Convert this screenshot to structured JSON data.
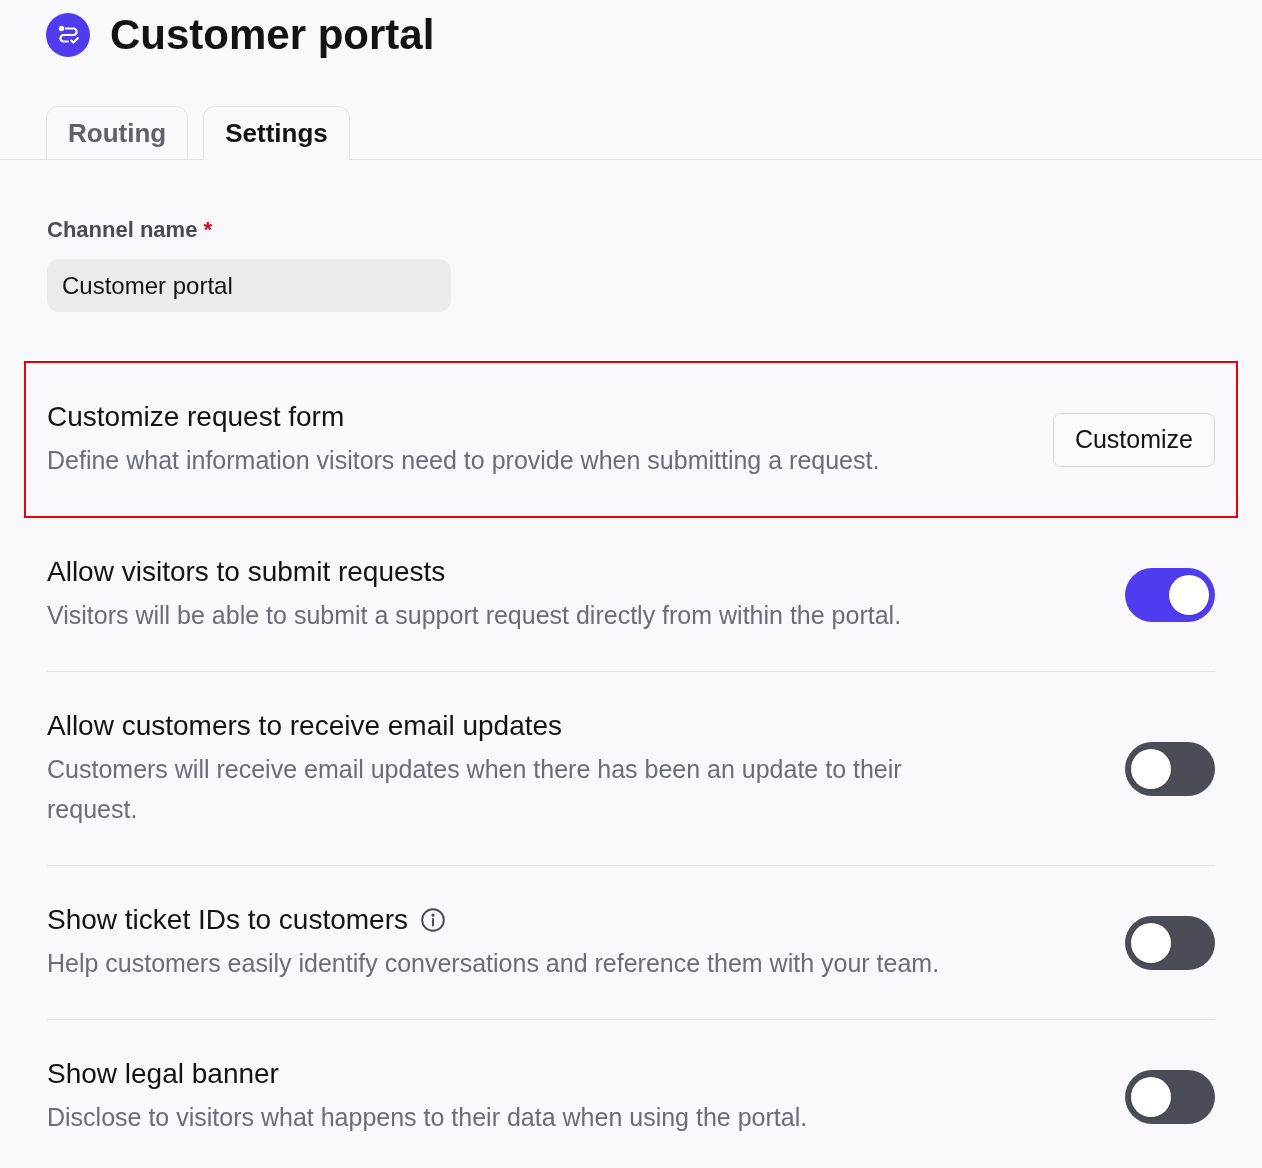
{
  "header": {
    "title": "Customer portal"
  },
  "tabs": [
    {
      "label": "Routing",
      "selected": false
    },
    {
      "label": "Settings",
      "selected": true
    }
  ],
  "channel_name": {
    "label": "Channel name",
    "required_mark": "*",
    "value": "Customer portal"
  },
  "settings": [
    {
      "kind": "button",
      "title": "Customize request form",
      "description": "Define what information visitors need to provide when submitting a request.",
      "button": "Customize",
      "highlighted": true
    },
    {
      "kind": "toggle",
      "title": "Allow visitors to submit requests",
      "description": "Visitors will be able to submit a support request directly from within the portal.",
      "on": true,
      "info": false
    },
    {
      "kind": "toggle",
      "title": "Allow customers to receive email updates",
      "description": "Customers will receive email updates when there has been an update to their request.",
      "on": false,
      "info": false
    },
    {
      "kind": "toggle",
      "title": "Show ticket IDs to customers",
      "description": "Help customers easily identify conversations and reference them with your team.",
      "on": false,
      "info": true
    },
    {
      "kind": "toggle",
      "title": "Show legal banner",
      "description": "Disclose to visitors what happens to their data when using the portal.",
      "on": false,
      "info": false
    }
  ]
}
